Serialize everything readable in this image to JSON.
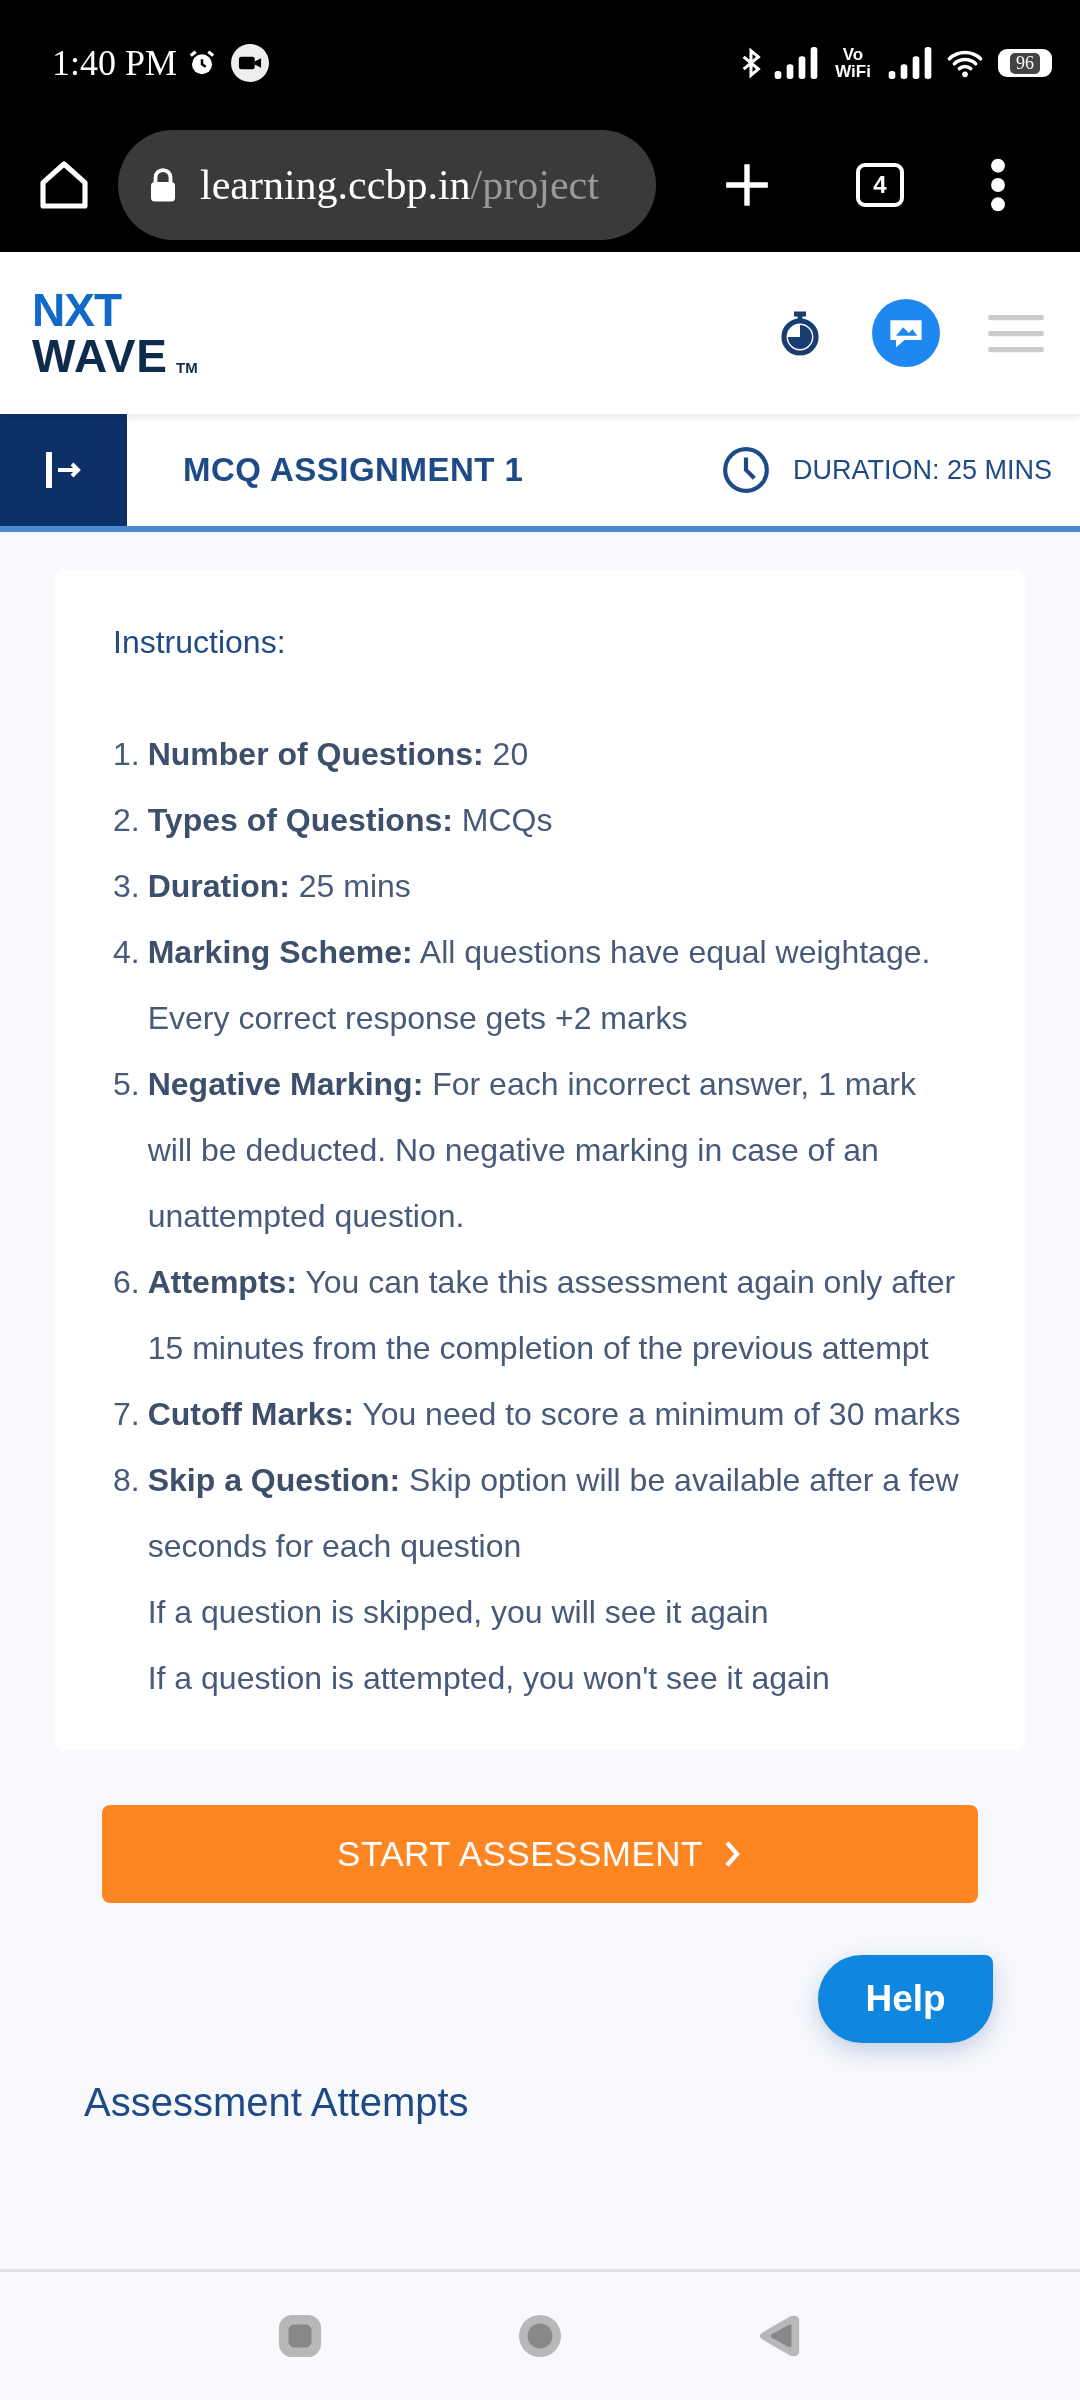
{
  "status_bar": {
    "time": "1:40 PM",
    "network_label": "Vo WiFi",
    "battery": "96"
  },
  "browser": {
    "url_host": "learning.ccbp.in",
    "url_path": "/project",
    "tab_count": "4"
  },
  "logo": {
    "line1": "NXT",
    "line2": "WAVE",
    "mark": "TM"
  },
  "assignment": {
    "title": "MCQ ASSIGNMENT 1",
    "duration": "DURATION: 25 MINS"
  },
  "instructions": {
    "heading": "Instructions:",
    "items": [
      {
        "number": "1.",
        "lines": [
          "**Number of Questions:** 20"
        ]
      },
      {
        "number": "2.",
        "lines": [
          "**Types of Questions:** MCQs"
        ]
      },
      {
        "number": "3.",
        "lines": [
          "**Duration:** 25 mins"
        ]
      },
      {
        "number": "4.",
        "lines": [
          "**Marking Scheme:** All questions have equal weightage. Every correct response gets +2 marks"
        ]
      },
      {
        "number": "5.",
        "lines": [
          "**Negative Marking:** For each incorrect answer, 1 mark will be deducted. No negative marking in case of an unattempted question."
        ]
      },
      {
        "number": "6.",
        "lines": [
          "**Attempts:** You can take this assessment again only after 15 minutes from the completion of the previous attempt"
        ]
      },
      {
        "number": "7.",
        "lines": [
          "**Cutoff Marks:** You need to score a minimum of 30 marks"
        ]
      },
      {
        "number": "8.",
        "lines": [
          "**Skip a Question:** Skip option will be available after a few seconds for each question",
          "If a question is skipped, you will see it again",
          "If a question is attempted, you won't see it again"
        ]
      }
    ]
  },
  "start_button": "START ASSESSMENT",
  "help_button": "Help",
  "section_heading": "Assessment Attempts"
}
